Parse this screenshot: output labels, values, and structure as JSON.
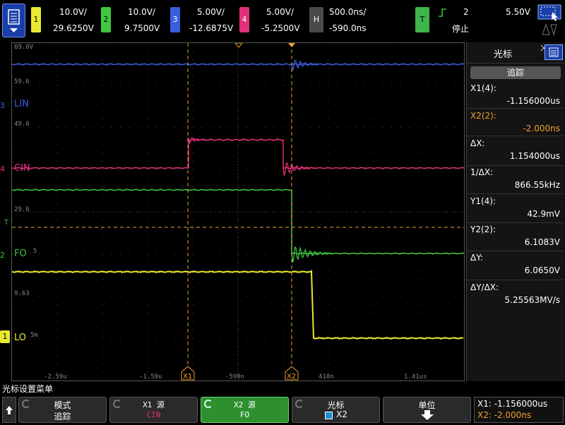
{
  "colors": {
    "ch1": "#e8e830",
    "ch2": "#3ec83e",
    "ch3": "#3a5ee0",
    "ch4": "#e0307a",
    "cursor": "#f0a030",
    "trig": "#3db54a"
  },
  "channels": [
    {
      "num": "1",
      "scale": "10.0V/",
      "offset": "29.6250V"
    },
    {
      "num": "2",
      "scale": "10.0V/",
      "offset": "9.7500V"
    },
    {
      "num": "3",
      "scale": "5.00V/",
      "offset": "-12.6875V"
    },
    {
      "num": "4",
      "scale": "5.00V/",
      "offset": "-5.2500V"
    }
  ],
  "horizontal": {
    "label": "H",
    "scale": "500.0ns/",
    "delay": "-590.0ns"
  },
  "trigger": {
    "label": "T",
    "source": "2",
    "level": "5.50V",
    "status": "停止"
  },
  "screen": {
    "labels": {
      "lin": "LIN",
      "cin": "CIN",
      "fo": "FO",
      "lo": "LO"
    },
    "grid_labels": [
      "69.6V",
      "59.6",
      "49.6",
      "29.6",
      "9.63"
    ],
    "time_labels": [
      "-2.59u",
      "-1.59u",
      "-590n",
      "410n",
      "1.41us"
    ],
    "cursor_tags": [
      "X1",
      "X2"
    ],
    "channel_markers": [
      "3",
      "4",
      "2",
      "1"
    ],
    "trig_marker": "T",
    "small_labels": [
      "5",
      "5m"
    ]
  },
  "side_panel": {
    "title": "光标",
    "track_button": "追踪",
    "x1_label": "X1(4):",
    "x1_value": "-1.156000us",
    "x2_label": "X2(2):",
    "x2_value": "-2.000ns",
    "dx_label": "ΔX:",
    "dx_value": "1.154000us",
    "inv_dx_label": "1/ΔX:",
    "inv_dx_value": "866.55kHz",
    "y1_label": "Y1(4):",
    "y1_value": "42.9mV",
    "y2_label": "Y2(2):",
    "y2_value": "6.1083V",
    "dy_label": "ΔY:",
    "dy_value": "6.0650V",
    "dydx_label": "ΔY/ΔX:",
    "dydx_value": "5.25563MV/s"
  },
  "menu": {
    "title": "光标设置菜单",
    "keys": [
      {
        "l1": "模式",
        "l2": "追踪"
      },
      {
        "l1": "X1 源",
        "l2": "CIN"
      },
      {
        "l1": "X2 源",
        "l2": "FO"
      },
      {
        "l1": "光标",
        "l2": "X2"
      },
      {
        "l1": "单位",
        "l2": ""
      }
    ],
    "readout_x1": "X1: -1.156000us",
    "readout_x2": "X2: -2.000ns"
  }
}
